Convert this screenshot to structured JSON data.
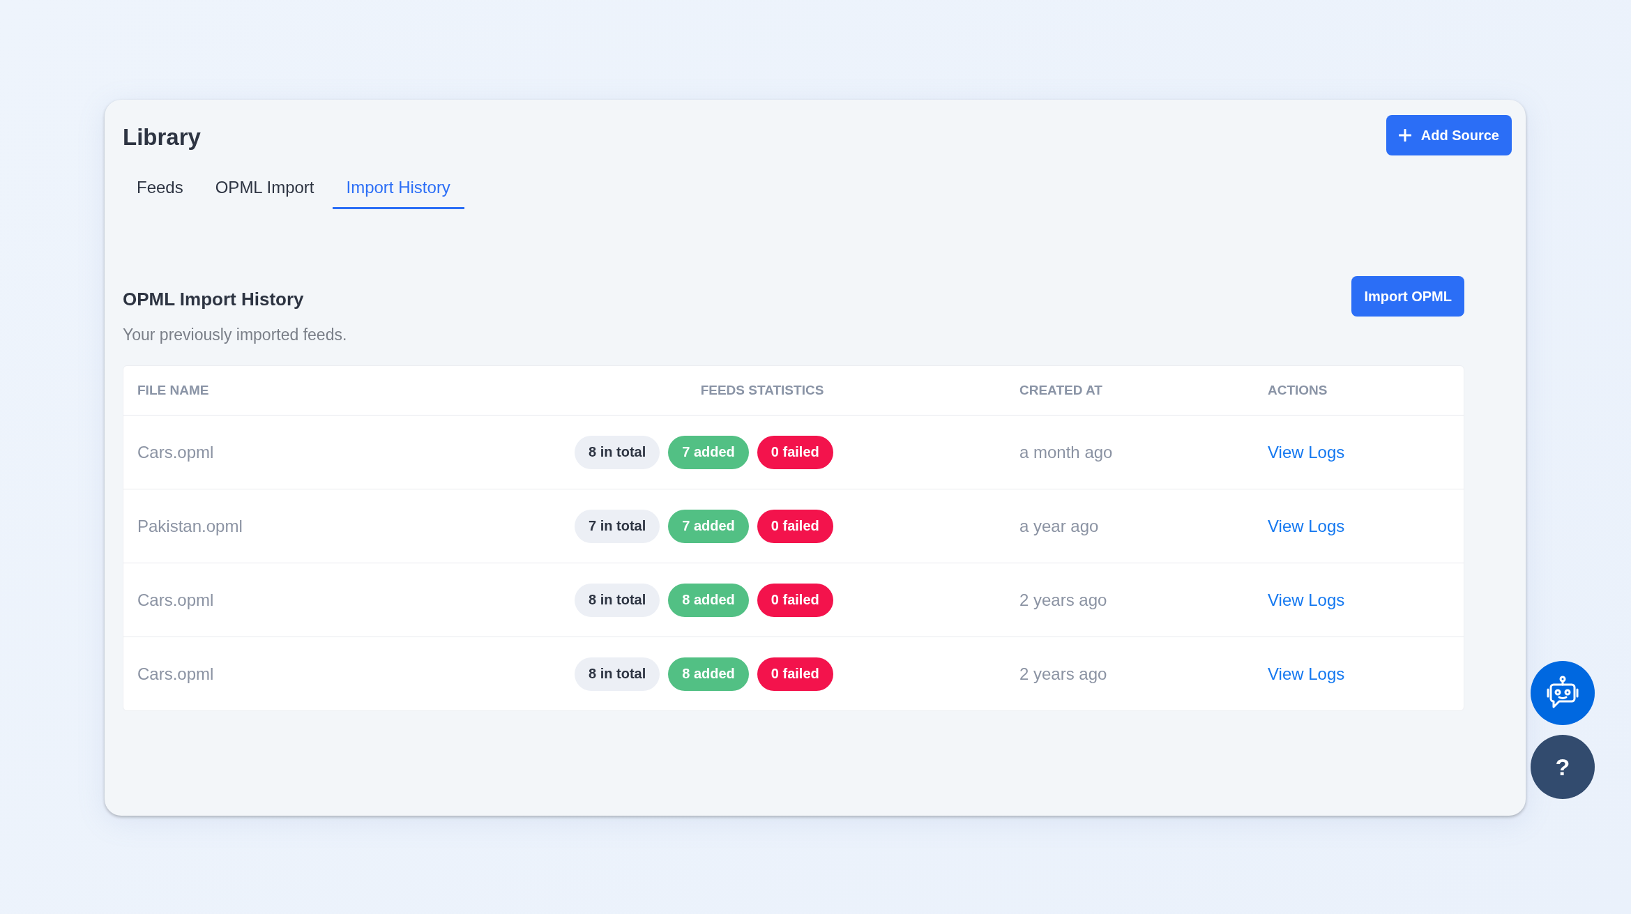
{
  "page": {
    "title": "Library",
    "add_button": "Add Source"
  },
  "tabs": [
    {
      "label": "Feeds",
      "selected": false
    },
    {
      "label": "OPML Import",
      "selected": false
    },
    {
      "label": "Import History",
      "selected": true
    }
  ],
  "section": {
    "title": "OPML Import History",
    "subtitle": "Your previously imported feeds.",
    "import_button": "Import OPML"
  },
  "table": {
    "columns": [
      "FILE NAME",
      "FEEDS STATISTICS",
      "CREATED AT",
      "ACTIONS"
    ],
    "rows": [
      {
        "file_name": "Cars.opml",
        "stats": [
          {
            "kind": "total",
            "text": "8 in total"
          },
          {
            "kind": "added",
            "text": "7 added"
          },
          {
            "kind": "failed",
            "text": "0 failed"
          }
        ],
        "created_at": "a month ago",
        "action": "View Logs"
      },
      {
        "file_name": "Pakistan.opml",
        "stats": [
          {
            "kind": "total",
            "text": "7 in total"
          },
          {
            "kind": "added",
            "text": "7 added"
          },
          {
            "kind": "failed",
            "text": "0 failed"
          }
        ],
        "created_at": "a year ago",
        "action": "View Logs"
      },
      {
        "file_name": "Cars.opml",
        "stats": [
          {
            "kind": "total",
            "text": "8 in total"
          },
          {
            "kind": "added",
            "text": "8 added"
          },
          {
            "kind": "failed",
            "text": "0 failed"
          }
        ],
        "created_at": "2 years ago",
        "action": "View Logs"
      },
      {
        "file_name": "Cars.opml",
        "stats": [
          {
            "kind": "total",
            "text": "8 in total"
          },
          {
            "kind": "added",
            "text": "8 added"
          },
          {
            "kind": "failed",
            "text": "0 failed"
          }
        ],
        "created_at": "2 years ago",
        "action": "View Logs"
      }
    ]
  },
  "help_button": "?"
}
